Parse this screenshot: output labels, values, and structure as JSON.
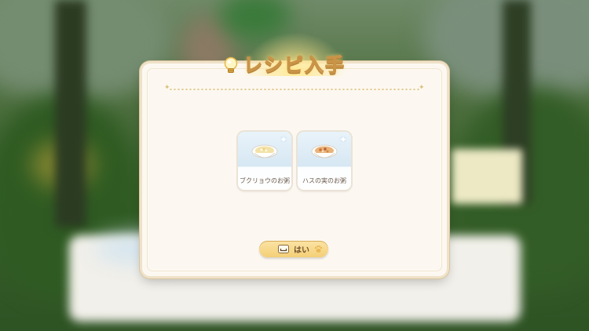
{
  "dialog": {
    "title": "レシピ入手",
    "recipes": [
      {
        "name": "ブクリョウのお粥",
        "icon": "white-porridge-bowl"
      },
      {
        "name": "ハスの実のお粥",
        "icon": "lotus-seed-porridge-bowl"
      }
    ],
    "confirm_label": "はい",
    "confirm_key_icon": "keyboard-space-key",
    "title_icon": "lightbulb"
  },
  "colors": {
    "panel": "#fcf8f1",
    "title_stroke": "#c99448",
    "button": "#f4cf76",
    "card_top": "#d6e7f3"
  }
}
